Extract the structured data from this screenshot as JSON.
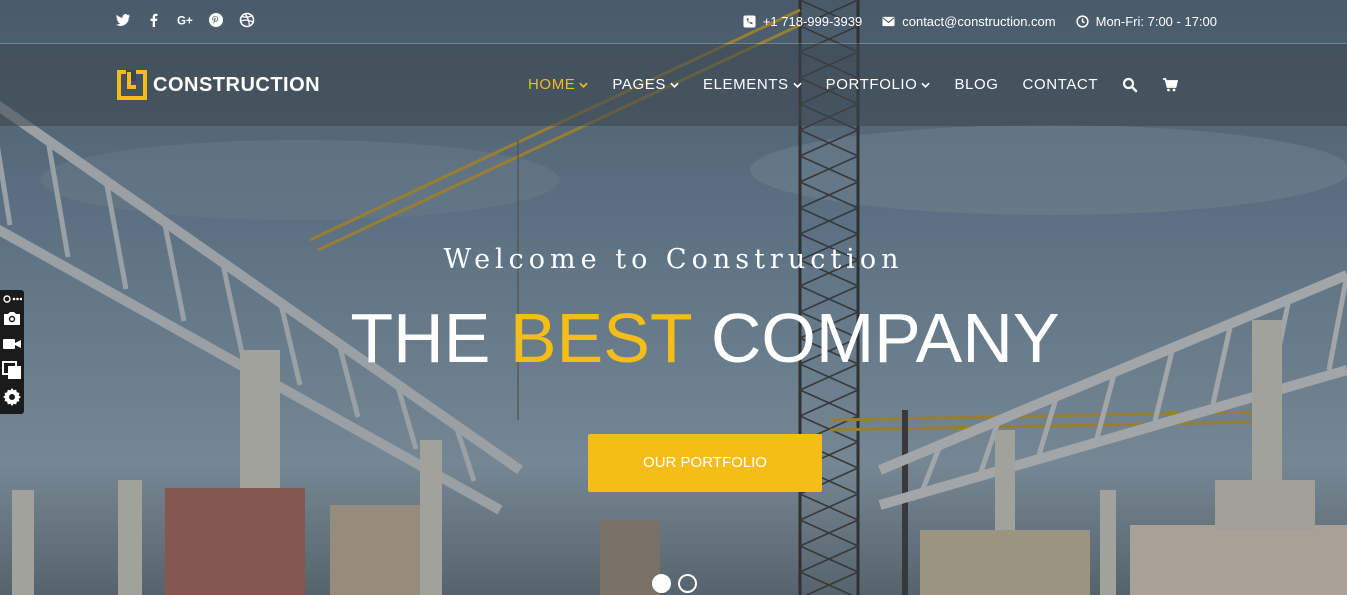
{
  "topbar": {
    "social": [
      {
        "icon": "twitter-icon",
        "glyph": "🐦"
      },
      {
        "icon": "facebook-icon",
        "glyph": "f"
      },
      {
        "icon": "google-plus-icon",
        "glyph": "G+"
      },
      {
        "icon": "pinterest-icon",
        "glyph": "℗"
      },
      {
        "icon": "dribbble-icon",
        "glyph": "◎"
      }
    ],
    "phone": "+1 718-999-3939",
    "email": "contact@construction.com",
    "hours": "Mon-Fri: 7:00 - 17:00"
  },
  "header": {
    "logo_text": "CONSTRUCTION",
    "nav": {
      "home": "HOME",
      "pages": "PAGES",
      "elements": "ELEMENTS",
      "portfolio": "PORTFOLIO",
      "blog": "BLOG",
      "contact": "CONTACT"
    }
  },
  "hero": {
    "welcome": "Welcome to Construction",
    "headline_start": "THE ",
    "headline_accent": "BEST",
    "headline_end": " COMPANY",
    "cta_label": "OUR PORTFOLIO",
    "slides_total": 2,
    "active_slide": 1
  },
  "colors": {
    "accent": "#f5bd17",
    "text": "#ffffff"
  }
}
